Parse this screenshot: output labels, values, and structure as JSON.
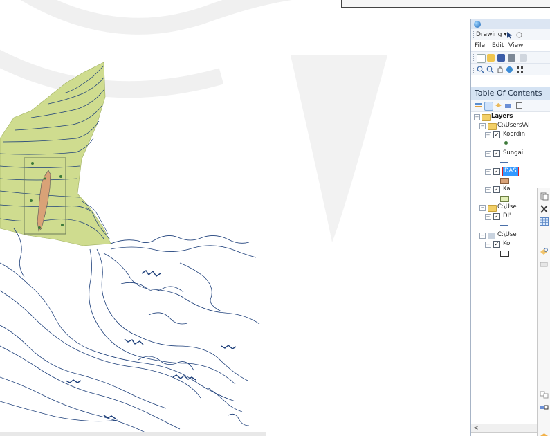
{
  "toolbar_drawing": {
    "label": "Drawing ▾"
  },
  "menu": {
    "file": "File",
    "edit": "Edit",
    "view": "View"
  },
  "toc": {
    "title": "Table Of Contents",
    "root": "Layers",
    "items": [
      {
        "name": "C:\\Users\\Al",
        "type": "folder"
      },
      {
        "name": "Koordin",
        "type": "layer",
        "checked": true,
        "symbol": "green-point"
      },
      {
        "name": "Sungai",
        "type": "layer",
        "checked": true,
        "symbol": "line"
      },
      {
        "name": "DAS",
        "type": "layer",
        "checked": true,
        "symbol": "brown-fill",
        "selected": true
      },
      {
        "name": "Ka",
        "type": "layer",
        "checked": true,
        "symbol": "lightgreen-fill"
      },
      {
        "name": "C:\\Use",
        "type": "folder"
      },
      {
        "name": "DI'",
        "type": "layer",
        "checked": true,
        "symbol": "line"
      },
      {
        "name": "C:\\Use",
        "type": "database"
      },
      {
        "name": "Ko",
        "type": "layer",
        "checked": true,
        "symbol": "empty-fill"
      }
    ]
  },
  "colors": {
    "watershed_fill": "#cfdc8f",
    "das_fill": "#d9a277",
    "contour": "#1d3f7a",
    "selection": "#3399ff"
  },
  "icons": {
    "toolbar": [
      "pointer-icon",
      "zoom-in-icon",
      "zoom-out-icon",
      "pan-icon",
      "globe-icon",
      "full-extent-icon",
      "new-icon",
      "open-icon",
      "save-icon",
      "print-icon"
    ],
    "context_menu": [
      "copy-icon",
      "remove-icon",
      "attribute-table-icon",
      "zoom-to-layer-icon",
      "visible-scale-icon",
      "join-icon",
      "symbology-icon"
    ]
  }
}
